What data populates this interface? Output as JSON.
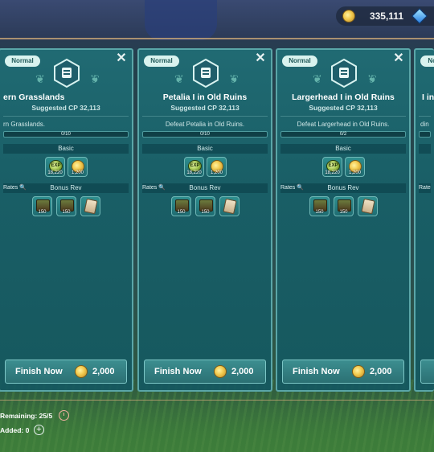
{
  "header": {
    "currency_gold": "335,111"
  },
  "panels": [
    {
      "badge": "Normal",
      "title": "ern Grasslands",
      "suggested_cp": "Suggested CP  32,113",
      "objective": "rn Grasslands.",
      "progress": "0/10",
      "basic_label": "Basic",
      "rates_label": "Rates",
      "bonus_label": "Bonus Rev",
      "basic_rewards": [
        "18,220",
        "1,200"
      ],
      "bonus_rewards": [
        "150",
        "150",
        ""
      ],
      "finish_label": "Finish Now",
      "finish_cost": "2,000"
    },
    {
      "badge": "Normal",
      "title": "Petalia I in Old Ruins",
      "suggested_cp": "Suggested CP  32,113",
      "objective": "Defeat Petalia in Old Ruins.",
      "progress": "0/10",
      "basic_label": "Basic",
      "rates_label": "Rates",
      "bonus_label": "Bonus Rev",
      "basic_rewards": [
        "18,220",
        "1,200"
      ],
      "bonus_rewards": [
        "150",
        "150",
        ""
      ],
      "finish_label": "Finish Now",
      "finish_cost": "2,000"
    },
    {
      "badge": "Normal",
      "title": "Largerhead I in Old Ruins",
      "suggested_cp": "Suggested CP  32,113",
      "objective": "Defeat Largerhead in Old Ruins.",
      "progress": "0/2",
      "basic_label": "Basic",
      "rates_label": "Rates",
      "bonus_label": "Bonus Rev",
      "basic_rewards": [
        "18,220",
        "1,200"
      ],
      "bonus_rewards": [
        "150",
        "150",
        ""
      ],
      "finish_label": "Finish Now",
      "finish_cost": "2,000"
    },
    {
      "badge": "Norma",
      "title": "I in",
      "objective": "din",
      "rates_label": "Rate"
    }
  ],
  "footer": {
    "remaining": "Remaining: 25/5",
    "added": "Added: 0"
  }
}
